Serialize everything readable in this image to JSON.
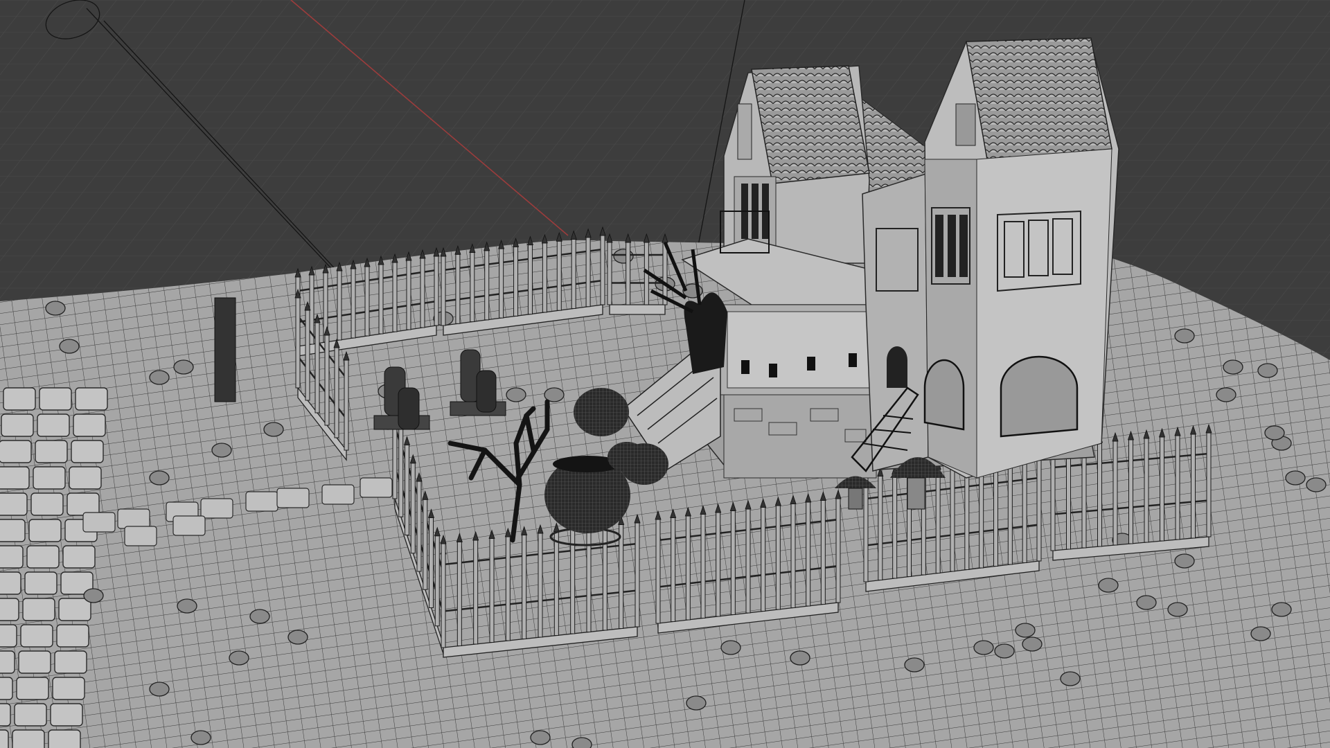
{
  "app": {
    "view": "3d-viewport",
    "shading": "wireframe-solid",
    "theme_colors": {
      "background": "#3d3d3d",
      "grid_line": "#4a4a4a",
      "x_axis": "#9c3c3c",
      "terrain": "#a8a8a8",
      "wire": "#303030",
      "house": "#b4b4b4",
      "dark_object": "#1e1e1e"
    }
  },
  "scene": {
    "objects": [
      {
        "name": "terrain",
        "type": "mesh"
      },
      {
        "name": "haunted-house",
        "type": "mesh"
      },
      {
        "name": "left-tower",
        "type": "mesh"
      },
      {
        "name": "right-tower",
        "type": "mesh"
      },
      {
        "name": "porch",
        "type": "mesh"
      },
      {
        "name": "stairs",
        "type": "mesh"
      },
      {
        "name": "cauldron",
        "type": "mesh"
      },
      {
        "name": "pumpkin-pile",
        "type": "mesh"
      },
      {
        "name": "dead-tree",
        "type": "mesh"
      },
      {
        "name": "spooky-tree",
        "type": "mesh"
      },
      {
        "name": "gravestones",
        "type": "mesh"
      },
      {
        "name": "mushroom-houses",
        "type": "mesh"
      },
      {
        "name": "iron-fences",
        "type": "mesh"
      },
      {
        "name": "stepping-stones",
        "type": "mesh"
      },
      {
        "name": "cobblestone-path",
        "type": "mesh"
      },
      {
        "name": "camera",
        "type": "camera"
      }
    ]
  }
}
